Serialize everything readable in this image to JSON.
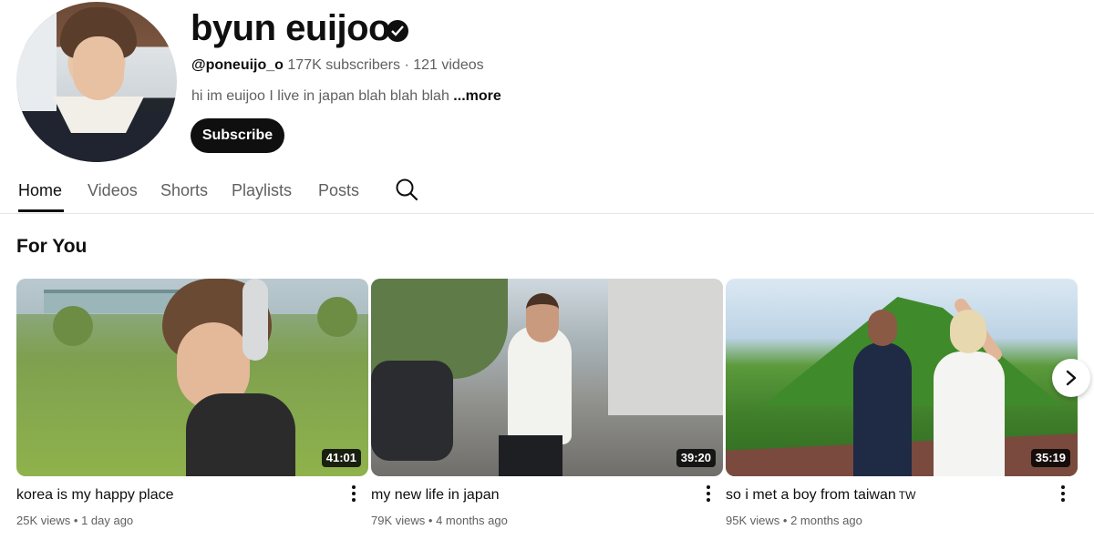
{
  "channel": {
    "name": "byun euijoo",
    "handle": "@poneuijo_o",
    "stats": "177K subscribers · 121 videos",
    "description": "hi im euijoo I live in japan blah blah blah ",
    "more_label": "...more",
    "subscribe_label": "Subscribe",
    "verified_icon": "verified-check-icon"
  },
  "tabs": [
    {
      "label": "Home",
      "active": true
    },
    {
      "label": "Videos",
      "active": false
    },
    {
      "label": "Shorts",
      "active": false
    },
    {
      "label": "Playlists",
      "active": false
    },
    {
      "label": "Posts",
      "active": false
    }
  ],
  "search_icon": "search-icon",
  "section": {
    "title": "For You",
    "videos": [
      {
        "title": "korea is my happy place",
        "tag": "",
        "duration": "41:01",
        "views": "25K views",
        "age": "1 day ago"
      },
      {
        "title": "my new life in japan",
        "tag": "",
        "duration": "39:20",
        "views": "79K views",
        "age": "4 months ago"
      },
      {
        "title": "so i met a boy from taiwan",
        "tag": "TW",
        "duration": "35:19",
        "views": "95K views",
        "age": "2 months ago"
      }
    ]
  },
  "separator": "•",
  "next_icon": "chevron-right-icon",
  "colors": {
    "text": "#0f0f0f",
    "secondary": "#606060",
    "subscribe_bg": "#0f0f0f"
  }
}
